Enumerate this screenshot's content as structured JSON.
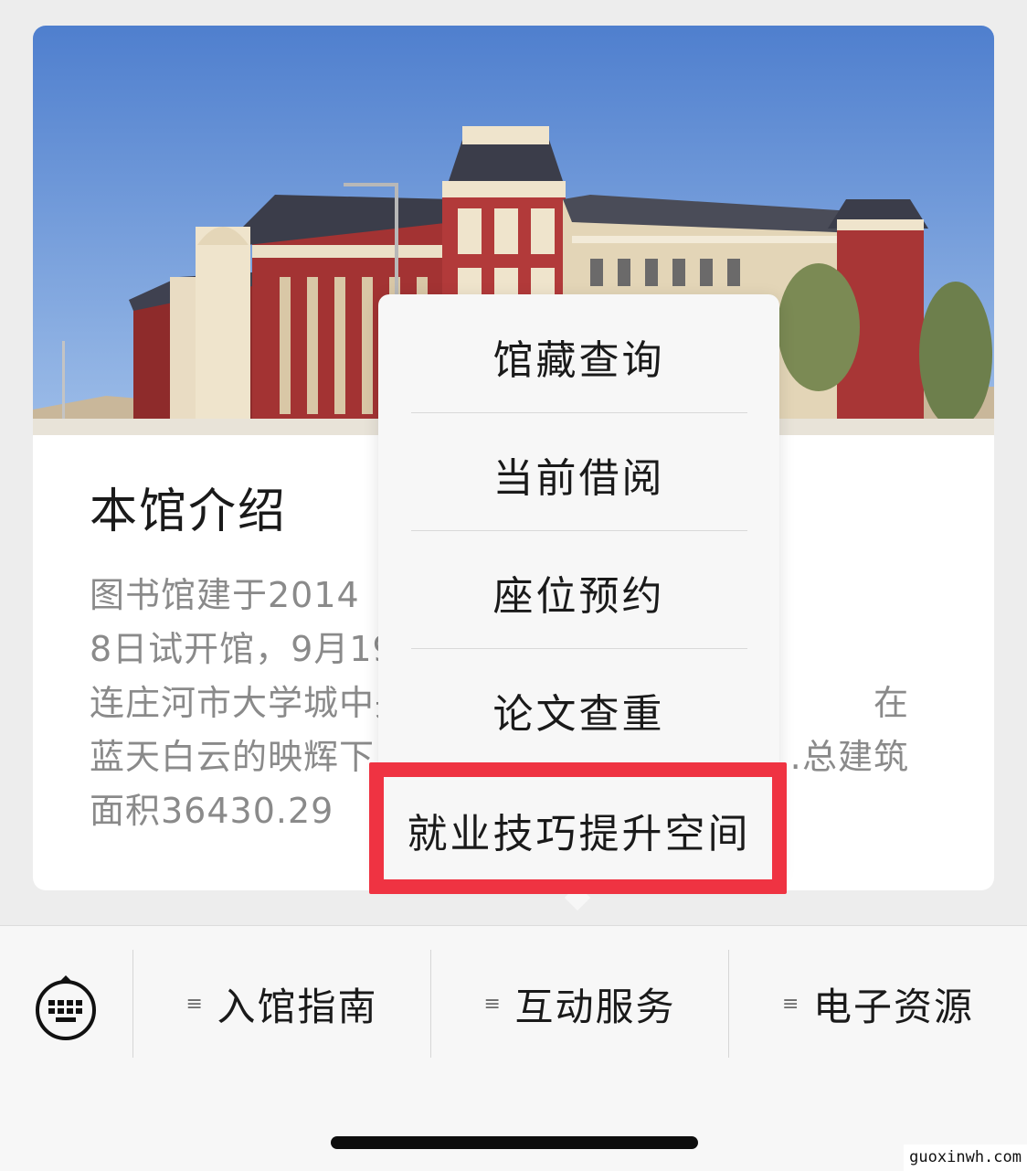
{
  "card": {
    "title": "本馆介绍",
    "description": "图书馆建于2014　　　　　　　　　　　　　　　8日试开馆，9月19日正式　　　　　　　　　　　连庄河市大学城中央，图　　　　　　　　　　　在蓝天白云的映辉下，更　　　　　　　　　…总建筑面积36430.29"
  },
  "popup": {
    "items": [
      {
        "label": "馆藏查询"
      },
      {
        "label": "当前借阅"
      },
      {
        "label": "座位预约"
      },
      {
        "label": "论文查重"
      },
      {
        "label": "就业技巧提升空间"
      }
    ],
    "highlight_color": "#ef3342"
  },
  "tabbar": {
    "keyboard_icon": "keyboard-icon",
    "tabs": [
      {
        "label": "入馆指南",
        "icon": "menu-icon"
      },
      {
        "label": "互动服务",
        "icon": "menu-icon"
      },
      {
        "label": "电子资源",
        "icon": "menu-icon"
      }
    ]
  },
  "watermark": "guoxinwh.com"
}
